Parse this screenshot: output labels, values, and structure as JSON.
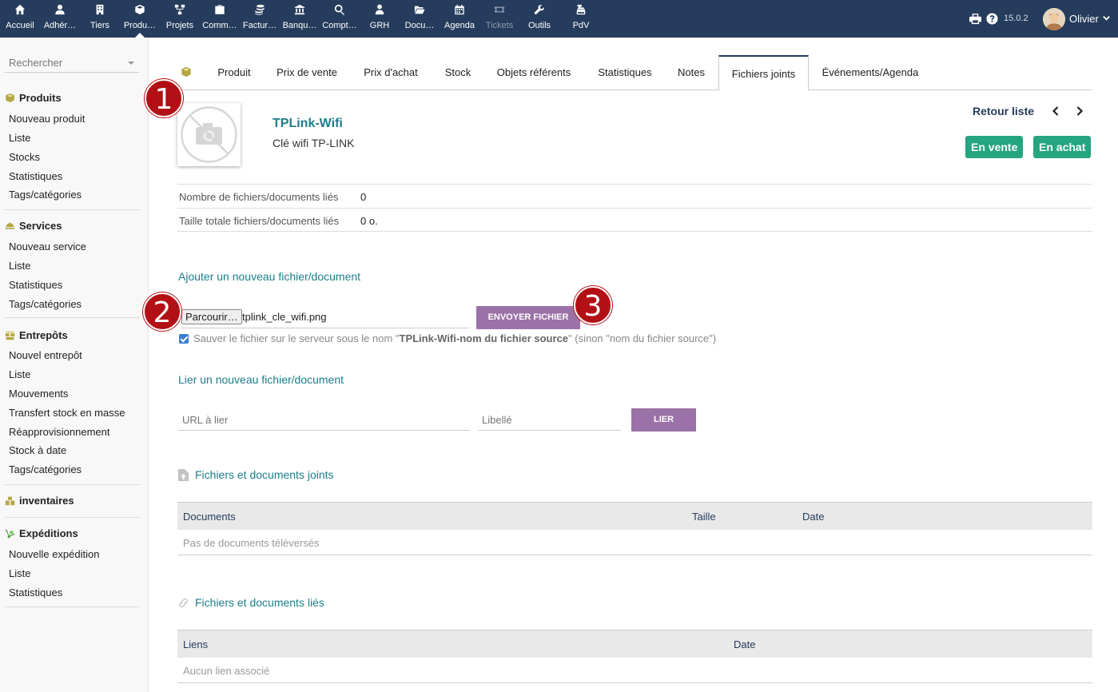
{
  "topnav": {
    "items": [
      {
        "label": "Accueil",
        "icon": "home-icon"
      },
      {
        "label": "Adhér…",
        "icon": "user-icon"
      },
      {
        "label": "Tiers",
        "icon": "building-icon"
      },
      {
        "label": "Produ…",
        "icon": "cube-icon"
      },
      {
        "label": "Projets",
        "icon": "sitemap-icon"
      },
      {
        "label": "Comm…",
        "icon": "suitcase-icon"
      },
      {
        "label": "Factur…",
        "icon": "coins-icon"
      },
      {
        "label": "Banqu…",
        "icon": "bank-icon"
      },
      {
        "label": "Compt…",
        "icon": "search-dollar-icon"
      },
      {
        "label": "GRH",
        "icon": "user-tie-icon"
      },
      {
        "label": "Docu…",
        "icon": "folder-open-icon"
      },
      {
        "label": "Agenda",
        "icon": "calendar-icon"
      },
      {
        "label": "Tickets",
        "icon": "ticket-icon"
      },
      {
        "label": "Outils",
        "icon": "wrench-icon"
      },
      {
        "label": "PdV",
        "icon": "cash-register-icon"
      }
    ],
    "version": "15.0.2",
    "user": "Olivier"
  },
  "sidebar": {
    "search_placeholder": "Rechercher",
    "sections": [
      {
        "title": "Produits",
        "items": [
          "Nouveau produit",
          "Liste",
          "Stocks",
          "Statistiques",
          "Tags/catégories"
        ]
      },
      {
        "title": "Services",
        "items": [
          "Nouveau service",
          "Liste",
          "Statistiques",
          "Tags/catégories"
        ]
      },
      {
        "title": "Entrepôts",
        "items": [
          "Nouvel entrepôt",
          "Liste",
          "Mouvements",
          "Transfert stock en masse",
          "Réapprovisionnement",
          "Stock à date",
          "Tags/catégories"
        ]
      },
      {
        "title": "inventaires",
        "items": []
      },
      {
        "title": "Expéditions",
        "items": [
          "Nouvelle expédition",
          "Liste",
          "Statistiques"
        ]
      }
    ]
  },
  "tabs": [
    "Produit",
    "Prix de vente",
    "Prix d'achat",
    "Stock",
    "Objets référents",
    "Statistiques",
    "Notes",
    "Fichiers joints",
    "Événements/Agenda"
  ],
  "product": {
    "ref": "TPLink-Wifi",
    "label": "Clé wifi TP-LINK",
    "back_list": "Retour liste",
    "badge_sell": "En vente",
    "badge_buy": "En achat"
  },
  "info": {
    "count_label": "Nombre de fichiers/documents liés",
    "count_value": "0",
    "size_label": "Taille totale fichiers/documents liés",
    "size_value": "0 o."
  },
  "upload": {
    "title": "Ajouter un nouveau fichier/document",
    "browse_label": "Parcourir…",
    "file_name": "tplink_cle_wifi.png",
    "send_label": "ENVOYER FICHIER",
    "checkbox_pre": "Sauver le fichier sur le serveur sous le nom \"",
    "checkbox_bold": "TPLink-Wifi-nom du fichier source",
    "checkbox_post": "\" (sinon \"nom du fichier source\")"
  },
  "link": {
    "title": "Lier un nouveau fichier/document",
    "url_placeholder": "URL à lier",
    "label_placeholder": "Libellé",
    "button": "LIER"
  },
  "attached": {
    "title": "Fichiers et documents joints",
    "col_docs": "Documents",
    "col_size": "Taille",
    "col_date": "Date",
    "empty": "Pas de documents téléversés"
  },
  "linked": {
    "title": "Fichiers et documents liés",
    "col_links": "Liens",
    "col_date": "Date",
    "empty": "Aucun lien associé"
  },
  "annotations": [
    "1",
    "2",
    "3"
  ]
}
